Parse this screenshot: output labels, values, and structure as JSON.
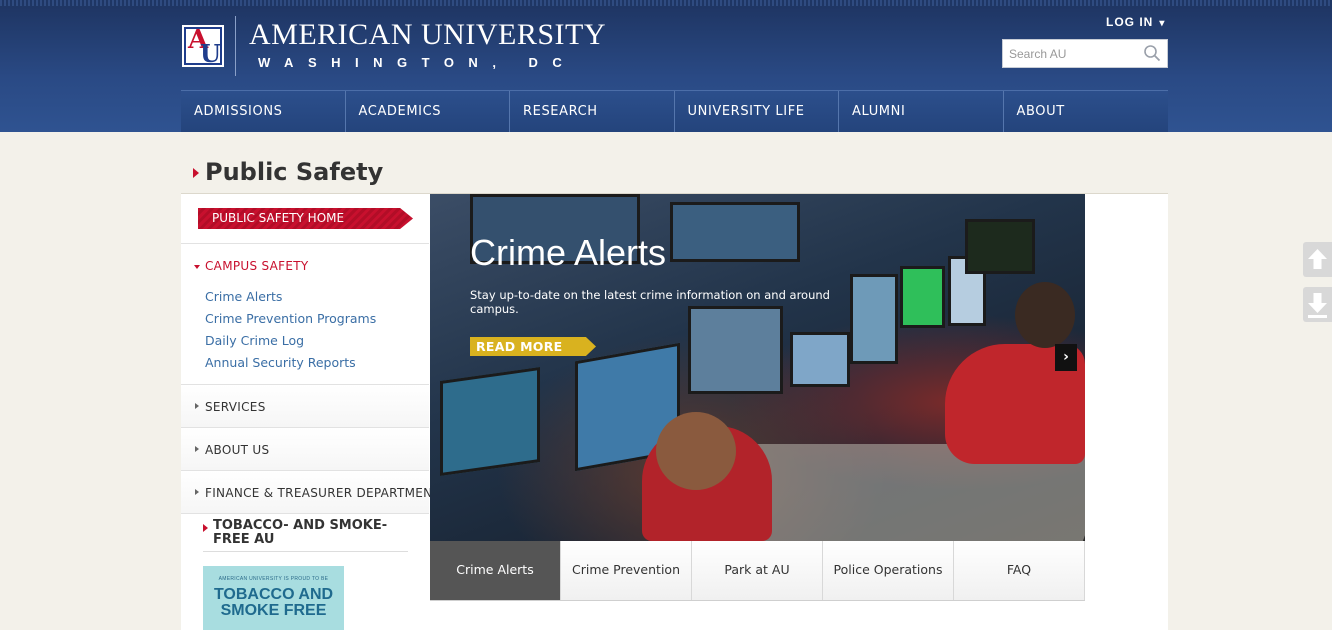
{
  "header": {
    "logo_title": "AMERICAN UNIVERSITY",
    "logo_subtitle": "WASHINGTON, DC",
    "logo_letters_a": "A",
    "logo_letters_u": "U",
    "login_label": "LOG IN",
    "search_placeholder": "Search AU"
  },
  "nav": {
    "items": [
      {
        "label": "ADMISSIONS"
      },
      {
        "label": "ACADEMICS"
      },
      {
        "label": "RESEARCH"
      },
      {
        "label": "UNIVERSITY LIFE"
      },
      {
        "label": "ALUMNI"
      },
      {
        "label": "ABOUT"
      }
    ]
  },
  "page": {
    "title": "Public Safety"
  },
  "sidebar": {
    "home_label": "PUBLIC SAFETY HOME",
    "campus_safety": "CAMPUS SAFETY",
    "sub_items": [
      {
        "label": "Crime Alerts"
      },
      {
        "label": "Crime Prevention Programs"
      },
      {
        "label": "Daily Crime Log"
      },
      {
        "label": "Annual Security Reports"
      }
    ],
    "sections": [
      {
        "label": "SERVICES"
      },
      {
        "label": "ABOUT US"
      },
      {
        "label": "FINANCE & TREASURER DEPARTMENTS"
      }
    ],
    "tobacco_title": "TOBACCO- AND SMOKE-FREE AU",
    "promo_small": "AMERICAN UNIVERSITY IS PROUD TO BE",
    "promo_big": "TOBACCO AND SMOKE FREE"
  },
  "hero": {
    "title": "Crime Alerts",
    "text": "Stay up-to-date on the latest crime information on and around campus.",
    "read_more": "READ MORE"
  },
  "tabs": [
    {
      "label": "Crime Alerts",
      "active": true
    },
    {
      "label": "Crime Prevention",
      "active": false
    },
    {
      "label": "Park at AU",
      "active": false
    },
    {
      "label": "Police Operations",
      "active": false
    },
    {
      "label": "FAQ",
      "active": false
    }
  ],
  "colors": {
    "header_blue": "#24447c",
    "accent_red": "#c8102e",
    "link_blue": "#3a6ea5",
    "read_more_gold": "#d9b21f"
  }
}
